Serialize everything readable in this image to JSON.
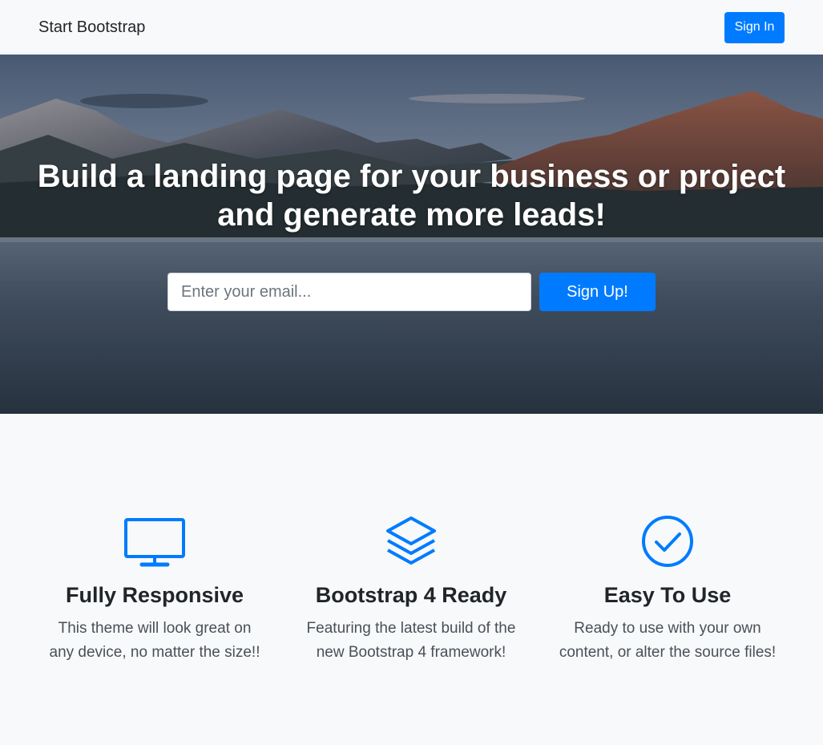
{
  "navbar": {
    "brand": "Start Bootstrap",
    "signin_label": "Sign In"
  },
  "hero": {
    "title": "Build a landing page for your business or project and generate more leads!",
    "email_placeholder": "Enter your email...",
    "signup_label": "Sign Up!"
  },
  "features": [
    {
      "icon": "monitor-icon",
      "title": "Fully Responsive",
      "text": "This theme will look great on any device, no matter the size!!"
    },
    {
      "icon": "layers-icon",
      "title": "Bootstrap 4 Ready",
      "text": "Featuring the latest build of the new Bootstrap 4 framework!"
    },
    {
      "icon": "check-circle-icon",
      "title": "Easy To Use",
      "text": "Ready to use with your own content, or alter the source files!"
    }
  ],
  "colors": {
    "primary": "#007bff",
    "background": "#f8f9fa",
    "text": "#212529"
  }
}
